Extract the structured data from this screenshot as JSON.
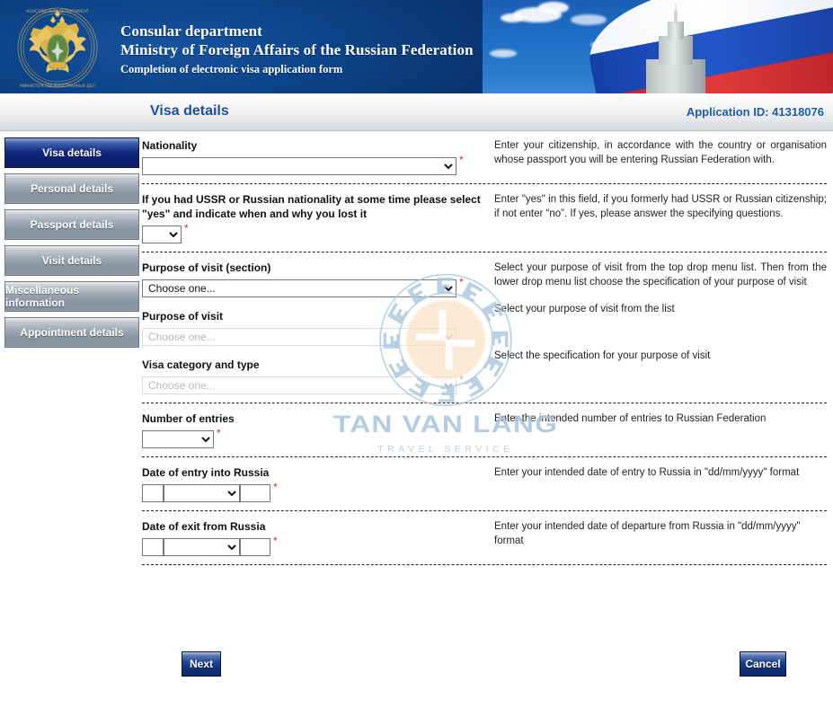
{
  "banner": {
    "emblem_icon": "russian-coat-of-arms-icon",
    "line1": "Consular department",
    "line2": "Ministry of Foreign Affairs of the Russian Federation",
    "line3": "Completion of electronic visa application form",
    "photo_icon": "mfa-building-and-flag-photo"
  },
  "header": {
    "page_title": "Visa details",
    "application_id_label": "Application ID: 41318076"
  },
  "sidebar": {
    "items": [
      {
        "label": "Visa details",
        "active": true
      },
      {
        "label": "Personal details",
        "active": false
      },
      {
        "label": "Passport details",
        "active": false
      },
      {
        "label": "Visit details",
        "active": false
      },
      {
        "label": "Miscellaneous information",
        "active": false
      },
      {
        "label": "Appointment details",
        "active": false
      }
    ]
  },
  "form": {
    "required_marker": "*",
    "placeholder_choose": "Choose one...",
    "rows": {
      "nationality": {
        "label": "Nationality",
        "value": "",
        "help": "Enter your citizenship, in accordance with the country or organisation whose passport you will be entering Russian Federation with."
      },
      "ussr": {
        "label": "If you had USSR or Russian nationality at some time please select \"yes\" and indicate when and why you lost it",
        "value": "",
        "help": "Enter \"yes\" in this field, if you formerly had USSR or Russian citizenship; if not enter “no”. If yes, please answer the specifying questions."
      },
      "purpose_section": {
        "label": "Purpose of visit (section)",
        "value": "Choose one...",
        "help": "Select your purpose of visit from the top drop menu list. Then from the lower drop menu list choose the specification of your purpose of visit"
      },
      "purpose": {
        "label": "Purpose of visit",
        "value": "Choose one...",
        "disabled": true,
        "help": "Select your purpose of visit from the list"
      },
      "visa_category": {
        "label": "Visa category and type",
        "value": "Choose one...",
        "disabled": true,
        "help": "Select the specification for your purpose of visit"
      },
      "entries": {
        "label": "Number of entries",
        "value": "",
        "help": "Enter the intended number of entries to Russian Federation"
      },
      "date_entry": {
        "label": "Date of entry into Russia",
        "day": "",
        "month": "",
        "year": "",
        "help": "Enter your intended date of entry to Russia in \"dd/mm/yyyy\" format"
      },
      "date_exit": {
        "label": "Date of exit from Russia",
        "day": "",
        "month": "",
        "year": "",
        "help": "Enter your intended date of departure from Russia in \"dd/mm/yyyy\" format"
      }
    }
  },
  "footer": {
    "next_label": "Next",
    "cancel_label": "Cancel"
  },
  "watermark": {
    "name": "TAN VAN LANG",
    "tagline": "TRAVEL SERVICE",
    "icon": "circular-meander-logo-icon"
  },
  "colors": {
    "banner_blue": "#0d4489",
    "title_blue": "#1d4f9e",
    "app_id_blue": "#1d5cab",
    "active_tab": "#10277e",
    "inactive_tab": "#8a96a3",
    "required_red": "#d42c2c",
    "watermark_blue": "#a8c4dd"
  }
}
